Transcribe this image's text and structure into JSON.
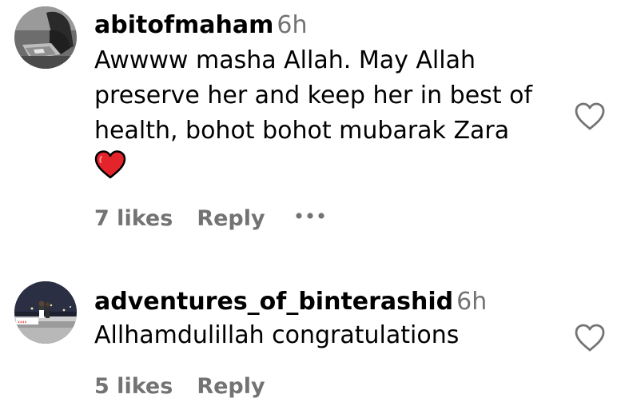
{
  "comments": [
    {
      "username": "abitofmaham",
      "time": "6h",
      "text": "Awwww masha Allah. May Allah preserve her and keep her in best of health, bohot bohot mubarak Zara",
      "emoji": "red-heart",
      "likes": "7 likes",
      "reply": "Reply",
      "show_more_options": true
    },
    {
      "username": "adventures_of_binterashid",
      "time": "6h",
      "text": "Allhamdulillah congratulations",
      "likes": "5 likes",
      "reply": "Reply",
      "show_more_options": false
    }
  ],
  "icons": {
    "like": "heart-outline-icon",
    "more": "more-options-icon",
    "emoji": "red-heart-emoji-icon"
  },
  "colors": {
    "primary_text": "#000000",
    "secondary_text": "#737373",
    "heart_emoji": "#e3242b",
    "icon_stroke": "#737373"
  }
}
